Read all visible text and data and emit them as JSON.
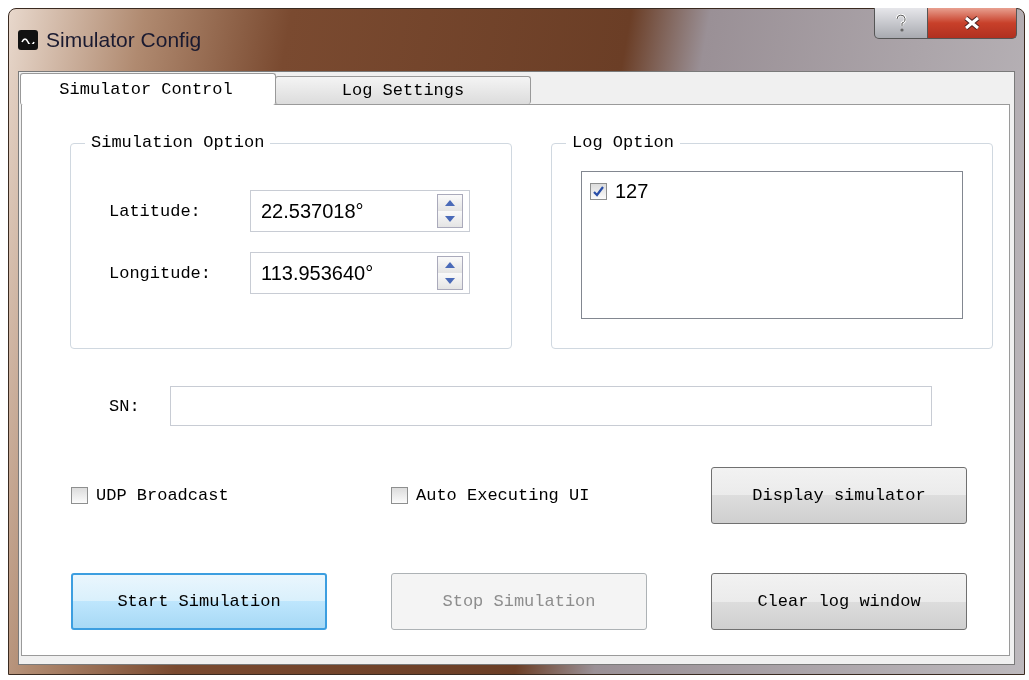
{
  "window": {
    "title": "Simulator Config"
  },
  "tabs": [
    {
      "label": "Simulator Control",
      "selected": true
    },
    {
      "label": "Log Settings",
      "selected": false
    }
  ],
  "simulation_option": {
    "title": "Simulation Option",
    "fields": [
      {
        "label": "Latitude:",
        "value": "22.537018°"
      },
      {
        "label": "Longitude:",
        "value": "113.953640°"
      }
    ]
  },
  "log_option": {
    "title": "Log Option",
    "items": [
      {
        "label": "127",
        "checked": true
      }
    ]
  },
  "sn": {
    "label": "SN:"
  },
  "options": [
    {
      "label": "UDP Broadcast",
      "checked": false
    },
    {
      "label": "Auto Executing UI",
      "checked": false
    }
  ],
  "buttons": [
    {
      "label": "Display simulator",
      "disabled": false,
      "focused": false
    },
    {
      "label": "Start Simulation",
      "disabled": false,
      "focused": true
    },
    {
      "label": "Stop Simulation",
      "disabled": true,
      "focused": false
    },
    {
      "label": "Clear log window",
      "disabled": false,
      "focused": false
    }
  ]
}
